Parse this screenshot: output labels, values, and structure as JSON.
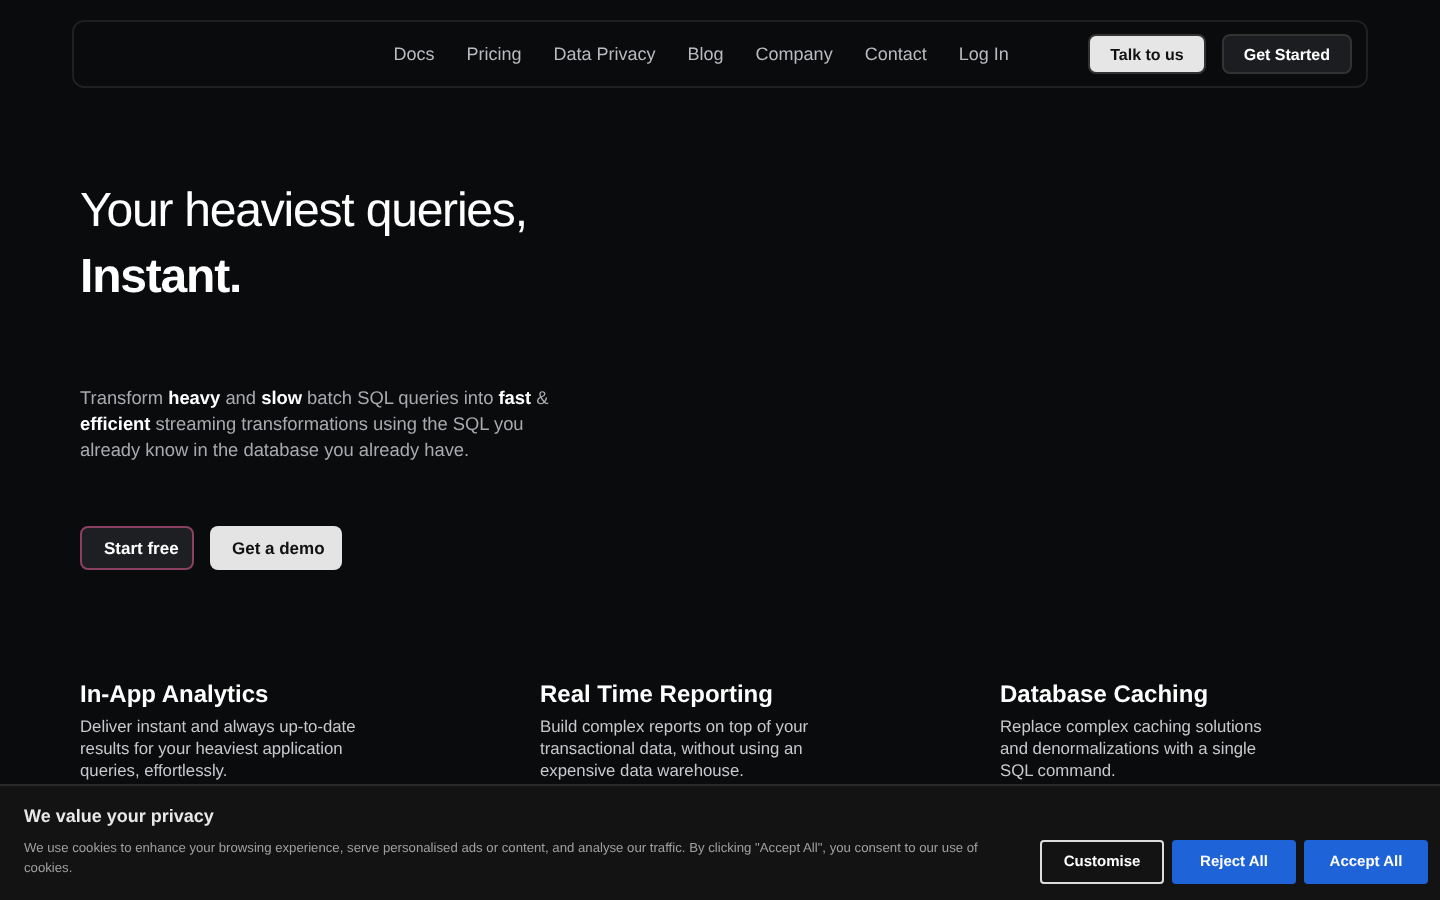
{
  "nav": {
    "links": [
      "Docs",
      "Pricing",
      "Data Privacy",
      "Blog",
      "Company",
      "Contact",
      "Log In"
    ],
    "buttons": [
      {
        "label": "Talk to us",
        "kind": "light"
      },
      {
        "label": "Get Started",
        "kind": "dark"
      }
    ]
  },
  "hero": {
    "title_line1": "Your heaviest queries,",
    "title_line2": "Instant.",
    "description": "Transform **heavy** and **slow** batch SQL queries into **fast** & **efficient** streaming transformations using the SQL you already know in the database you already have.",
    "buttons": [
      {
        "label": "Start free",
        "kind": "gradient"
      },
      {
        "label": "Get a demo",
        "kind": "light"
      }
    ]
  },
  "features": [
    {
      "title": "In-App Analytics",
      "text": "Deliver instant and always up-to-date results for your heaviest application queries, effortlessly."
    },
    {
      "title": "Real Time Reporting",
      "text": "Build complex reports on top of your transactional data, without using an expensive data warehouse."
    },
    {
      "title": "Database Caching",
      "text": "Replace complex caching solutions and denormalizations with a single SQL command."
    }
  ],
  "cookie_banner": {
    "title": "We value your privacy",
    "text": "We use cookies to enhance your browsing experience, serve personalised ads or content, and analyse our traffic. By clicking \"Accept All\", you consent to our use of cookies.",
    "buttons": [
      {
        "label": "Customise",
        "kind": "outline"
      },
      {
        "label": "Reject All",
        "kind": "primary"
      },
      {
        "label": "Accept All",
        "kind": "primary"
      }
    ]
  }
}
